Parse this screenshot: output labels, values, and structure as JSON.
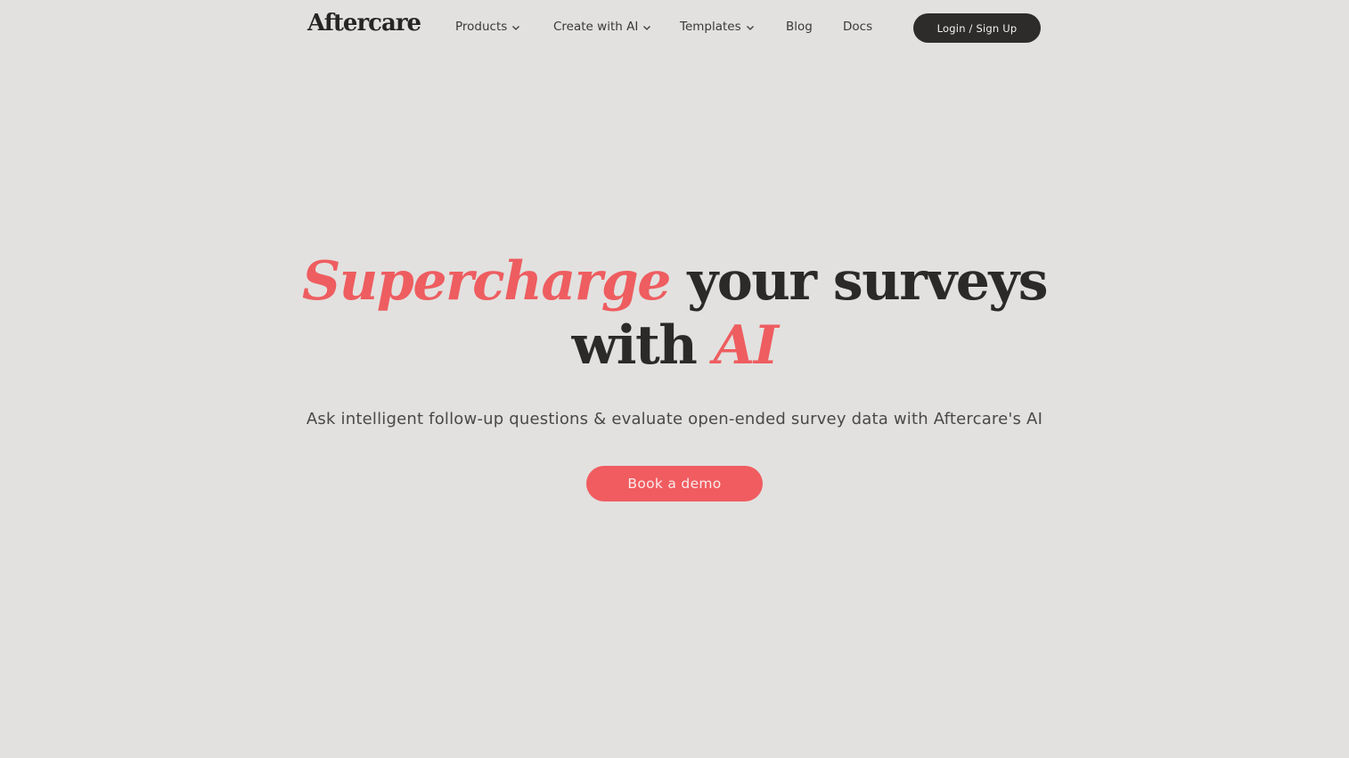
{
  "brand": {
    "logo_text": "Aftercare",
    "accent_color": "#ee5d60",
    "dark_color": "#2d2c2a",
    "background_color": "#e2e1df"
  },
  "nav": {
    "items": [
      {
        "label": "Products",
        "has_dropdown": true,
        "icon": "chevron-down-icon"
      },
      {
        "label": "Create with AI",
        "has_dropdown": true,
        "icon": "chevron-down-icon"
      },
      {
        "label": "Templates",
        "has_dropdown": true,
        "icon": "chevron-down-icon"
      },
      {
        "label": "Blog",
        "has_dropdown": false
      },
      {
        "label": "Docs",
        "has_dropdown": false
      }
    ],
    "login_label": "Login / Sign Up"
  },
  "hero": {
    "title_accent_1": "Supercharge",
    "title_plain_1": "your surveys",
    "title_plain_2": "with",
    "title_accent_2": "AI",
    "subtitle": "Ask intelligent follow-up questions & evaluate open-ended survey data with Aftercare's AI",
    "cta_label": "Book a demo"
  }
}
